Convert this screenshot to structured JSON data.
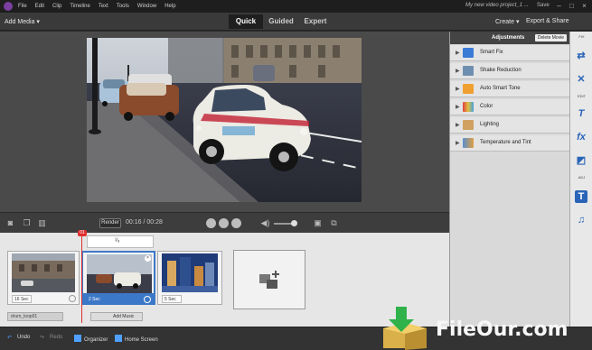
{
  "menubar": {
    "items": [
      "File",
      "Edit",
      "Clip",
      "Timeline",
      "Text",
      "Tools",
      "Window",
      "Help"
    ],
    "project_title": "My new video project_1 ...",
    "save_label": "Save"
  },
  "modebar": {
    "add_media": "Add Media ▾",
    "tabs": [
      {
        "label": "Quick",
        "active": true
      },
      {
        "label": "Guided",
        "active": false
      },
      {
        "label": "Expert",
        "active": false
      }
    ],
    "create": "Create ▾",
    "export": "Export & Share"
  },
  "transport": {
    "render": "Render",
    "timecode": "00:16 / 00:28"
  },
  "timeline": {
    "playhead": "01",
    "ruler": "¹⁄₈",
    "clips": [
      {
        "duration": "16 Sec",
        "selected": false
      },
      {
        "duration": "2 Sec",
        "selected": true
      },
      {
        "duration": "5 Sec",
        "selected": false
      }
    ],
    "track_label": "drum_loop01",
    "add_music": "Add Music"
  },
  "bottombar": {
    "undo": "Undo",
    "redo": "Redo",
    "organizer": "Organizer",
    "home_screen": "Home Screen"
  },
  "adjustments": {
    "title": "Adjustments",
    "delete_movie": "Delete Movie",
    "items": [
      {
        "label": "Smart Fix",
        "icon": "smart-fix-icon",
        "color": "#3a7bd5"
      },
      {
        "label": "Shake Reduction",
        "icon": "shake-reduction-icon",
        "color": "#6f8fb0"
      },
      {
        "label": "Auto Smart Tone",
        "icon": "smart-tone-icon",
        "color": "#f0a030"
      },
      {
        "label": "Color",
        "icon": "color-icon",
        "color": "#e0b040"
      },
      {
        "label": "Lighting",
        "icon": "lighting-icon",
        "color": "#d0a060"
      },
      {
        "label": "Temperature and Tint",
        "icon": "temperature-icon",
        "color": "#5a8fd0"
      }
    ]
  },
  "tool_rail": {
    "fix_label": "FIX",
    "edit_label": "EDIT",
    "adj_label": "ADJ"
  },
  "watermark": {
    "text": "FileOur.com"
  },
  "colors": {
    "accent": "#3c78c8",
    "playhead": "#e03030",
    "brand": "#7a3fa0"
  }
}
